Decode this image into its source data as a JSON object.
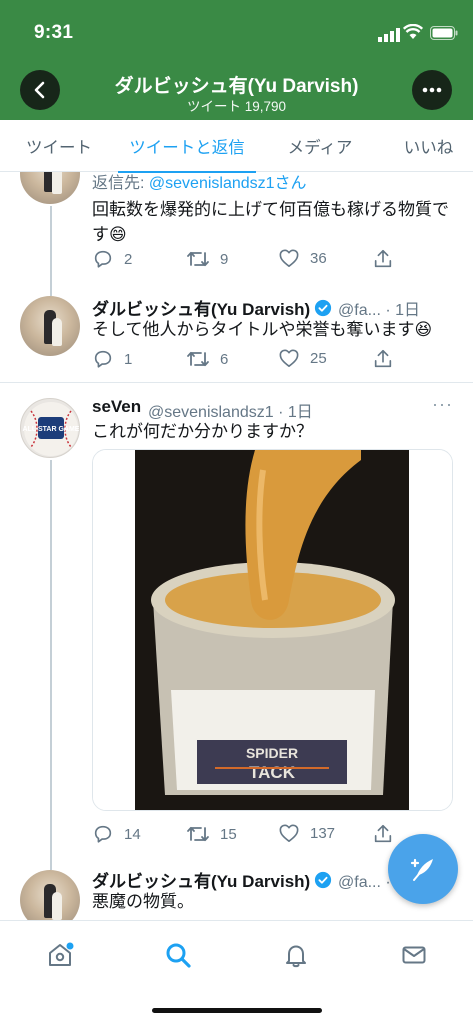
{
  "status": {
    "time": "9:31"
  },
  "header": {
    "title": "ダルビッシュ有(Yu Darvish)",
    "subtitle": "ツイート 19,790",
    "bg_color": "#3a8a45",
    "back_icon": "chevron-left-icon",
    "more_icon": "more-icon"
  },
  "tabs": [
    {
      "label": "ツイート"
    },
    {
      "label": "ツイートと返信",
      "active": true
    },
    {
      "label": "メディア"
    },
    {
      "label": "いいね"
    }
  ],
  "tweets": [
    {
      "reply_prefix": "返信先: ",
      "reply_handle": "@sevenislandsz1さん",
      "text": "回転数を爆発的に上げて何百億も稼げる物質です😄",
      "replies": "2",
      "retweets": "9",
      "likes": "36"
    },
    {
      "name": "ダルビッシュ有(Yu Darvish)",
      "meta": "@fa... · 1日",
      "text": "そして他人からタイトルや栄誉も奪います😆",
      "replies": "1",
      "retweets": "6",
      "likes": "25"
    },
    {
      "name": "seVen",
      "meta": "@sevenislandsz1 · 1日",
      "text": "これが何だか分かりますか？",
      "media_label_line1": "SPIDER",
      "media_label_line2": "TACK",
      "replies": "14",
      "retweets": "15",
      "likes": "137"
    },
    {
      "name": "ダルビッシュ有(Yu Darvish)",
      "meta": "@fa... · 1日",
      "text": "悪魔の物質。"
    }
  ],
  "avatar_seven_text": "ALL STAR GAME",
  "colors": {
    "accent": "#1da1f2",
    "muted": "#657786"
  }
}
